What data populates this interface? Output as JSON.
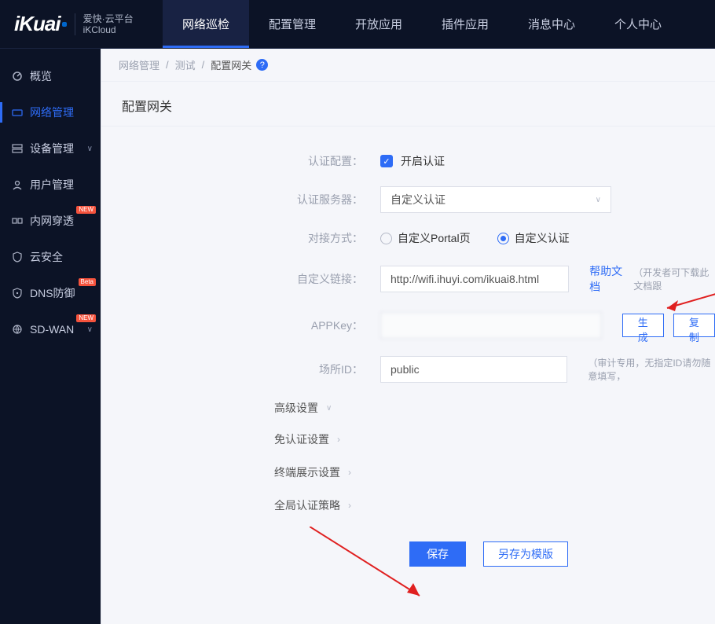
{
  "logo": {
    "main": "iKuai",
    "sub1": "爱快·云平台",
    "sub2": "iKCloud"
  },
  "nav": {
    "tabs": [
      {
        "label": "网络巡检",
        "active": true
      },
      {
        "label": "配置管理"
      },
      {
        "label": "开放应用"
      },
      {
        "label": "插件应用"
      },
      {
        "label": "消息中心"
      },
      {
        "label": "个人中心"
      }
    ]
  },
  "sidebar": {
    "items": [
      {
        "label": "概览",
        "icon": "dashboard"
      },
      {
        "label": "网络管理",
        "icon": "network",
        "active": true
      },
      {
        "label": "设备管理",
        "icon": "device",
        "expandable": true
      },
      {
        "label": "用户管理",
        "icon": "user"
      },
      {
        "label": "内网穿透",
        "icon": "tunnel",
        "badge": "NEW"
      },
      {
        "label": "云安全",
        "icon": "shield"
      },
      {
        "label": "DNS防御",
        "icon": "dns",
        "badge": "Beta"
      },
      {
        "label": "SD-WAN",
        "icon": "sdwan",
        "expandable": true,
        "badge": "NEW"
      }
    ]
  },
  "breadcrumb": {
    "a": "网络管理",
    "b": "测试",
    "c": "配置网关"
  },
  "page_title": "配置网关",
  "form": {
    "auth_config": {
      "label": "认证配置：",
      "checkbox_label": "开启认证"
    },
    "auth_server": {
      "label": "认证服务器：",
      "selected": "自定义认证"
    },
    "mode": {
      "label": "对接方式：",
      "opt1": "自定义Portal页",
      "opt2": "自定义认证"
    },
    "custom_link": {
      "label": "自定义链接：",
      "value": "http://wifi.ihuyi.com/ikuai8.html",
      "help_link": "帮助文档",
      "hint": "（开发者可下载此文档跟"
    },
    "appkey": {
      "label": "APPKey：",
      "value": "",
      "generate": "生成",
      "copy": "复制"
    },
    "place_id": {
      "label": "场所ID：",
      "value": "public",
      "hint": "（审计专用，无指定ID请勿随意填写，"
    }
  },
  "sections": {
    "advanced": "高级设置",
    "noauth": "免认证设置",
    "display": "终端展示设置",
    "global": "全局认证策略"
  },
  "actions": {
    "save": "保存",
    "save_as": "另存为模版"
  }
}
